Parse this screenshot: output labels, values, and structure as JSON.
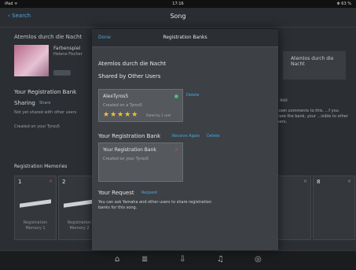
{
  "status": {
    "left": "iPad ᯤ",
    "time": "17:16",
    "right": "✻ 63 %"
  },
  "nav": {
    "back": "‹ Search",
    "title": "Song"
  },
  "background": {
    "song_title": "Atemlos durch die Nacht",
    "artist": "Farbenspiel",
    "artist_sub": "Helene Fischer",
    "reg_bank_label": "Your Registration Bank",
    "sharing_label": "Sharing",
    "sharing_sub": "Share",
    "not_shared": "Not yet shared with other users",
    "created": "Created on your Tyros5",
    "right_card_title": "Atemlos durch die Nacht",
    "right_add": "Add",
    "right_text": "...own comments to this. ...f you share the bank, your ...isible to other users.",
    "memories_label": "Registration Memories",
    "memories": [
      {
        "num": "1",
        "label": "Registration Memory 1",
        "dot": "×",
        "dot_color": "#e04848"
      },
      {
        "num": "2",
        "label": "Registration Memory 2",
        "dot": "●",
        "dot_color": "#4ec27a"
      },
      {
        "num": "",
        "label": "",
        "dot": "×",
        "dot_color": "#8f9499"
      },
      {
        "num": "8",
        "label": "",
        "dot": "×",
        "dot_color": "#8f9499"
      }
    ]
  },
  "modal": {
    "done": "Done",
    "title": "Registration Banks",
    "song": "Atemlos durch die Nacht",
    "shared_by": "Shared by Other Users",
    "shared_card": {
      "name": "AlexTyros5",
      "sub": "Created on a Tyros5",
      "stars": "★★★★★",
      "rated": "Rated by 1 user"
    },
    "delete1": "Delete",
    "your_bank_label": "Your Registration Bank",
    "receive_again": "Receive Again",
    "delete2": "Delete",
    "your_card": {
      "name": "Your Registration Bank",
      "sub": "Created on your Tyros5"
    },
    "request_label": "Your Request",
    "request_link": "Request",
    "request_text": "You can ask Yamaha and other users to share registration banks for this song."
  },
  "tabs": [
    {
      "name": "home-tab-icon",
      "glyph": "⌂"
    },
    {
      "name": "list-tab-icon",
      "glyph": "≣"
    },
    {
      "name": "download-tab-icon",
      "glyph": "⇩"
    },
    {
      "name": "music-tab-icon",
      "glyph": "♫"
    },
    {
      "name": "settings-tab-icon",
      "glyph": "◎"
    }
  ]
}
